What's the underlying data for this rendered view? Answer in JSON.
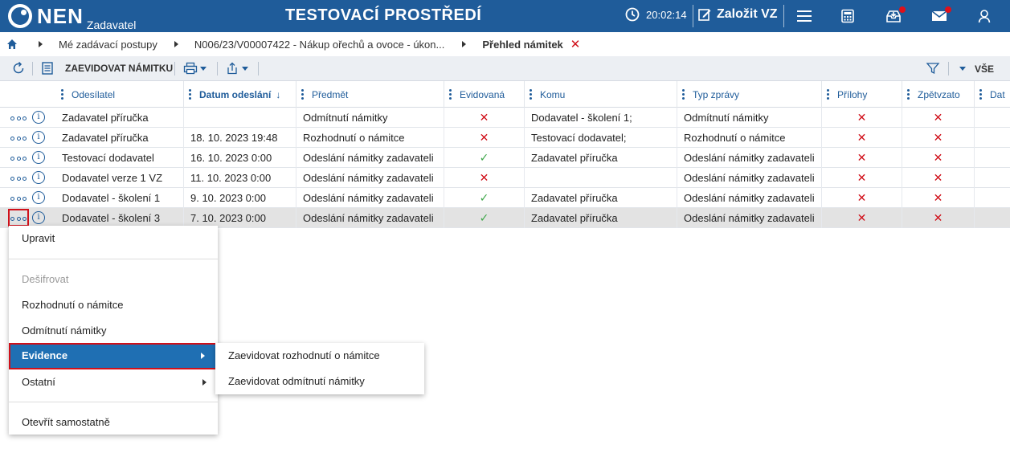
{
  "topbar": {
    "logo_text": "NEN",
    "logo_sub": "Zadavatel",
    "environment_title": "TESTOVACÍ PROSTŘEDÍ",
    "clock": "20:02:14",
    "create_label": "Založit VZ"
  },
  "breadcrumb": {
    "items": [
      "Mé zadávací postupy",
      "N006/23/V00007422 - Nákup ořechů a ovoce - úkon...",
      "Přehled námitek"
    ]
  },
  "toolbar": {
    "register_label": "ZAEVIDOVAT NÁMITKU",
    "filter_value": "VŠE"
  },
  "grid": {
    "columns": [
      "Odesílatel",
      "Datum odeslání",
      "Předmět",
      "Evidovaná",
      "Komu",
      "Typ zprávy",
      "Přílohy",
      "Zpětvzato",
      "Dat"
    ],
    "sort_indicator": "↓",
    "rows": [
      {
        "odesilatel": "Zadavatel příručka",
        "datum": "",
        "predmet": "Odmítnutí námitky",
        "evidovana": "✕",
        "komu": "Dodavatel - školení 1;",
        "typ": "Odmítnutí námitky",
        "prilohy": "✕",
        "zpetvzato": "✕"
      },
      {
        "odesilatel": "Zadavatel příručka",
        "datum": "18. 10. 2023 19:48",
        "predmet": "Rozhodnutí o námitce",
        "evidovana": "✕",
        "komu": "Testovací dodavatel;",
        "typ": "Rozhodnutí o námitce",
        "prilohy": "✕",
        "zpetvzato": "✕"
      },
      {
        "odesilatel": "Testovací dodavatel",
        "datum": "16. 10. 2023 0:00",
        "predmet": "Odeslání námitky zadavateli",
        "evidovana": "✓",
        "komu": "Zadavatel příručka",
        "typ": "Odeslání námitky zadavateli",
        "prilohy": "✕",
        "zpetvzato": "✕"
      },
      {
        "odesilatel": "Dodavatel verze 1 VZ",
        "datum": "11. 10. 2023 0:00",
        "predmet": "Odeslání námitky zadavateli",
        "evidovana": "✕",
        "komu": "",
        "typ": "Odeslání námitky zadavateli",
        "prilohy": "✕",
        "zpetvzato": "✕"
      },
      {
        "odesilatel": "Dodavatel - školení 1",
        "datum": "9. 10. 2023 0:00",
        "predmet": "Odeslání námitky zadavateli",
        "evidovana": "✓",
        "komu": "Zadavatel příručka",
        "typ": "Odeslání námitky zadavateli",
        "prilohy": "✕",
        "zpetvzato": "✕"
      },
      {
        "odesilatel": "Dodavatel - školení 3",
        "datum": "7. 10. 2023 0:00",
        "predmet": "Odeslání námitky zadavateli",
        "evidovana": "✓",
        "komu": "Zadavatel příručka",
        "typ": "Odeslání námitky zadavateli",
        "prilohy": "✕",
        "zpetvzato": "✕"
      }
    ]
  },
  "context_menu": {
    "edit": "Upravit",
    "decrypt": "Dešifrovat",
    "decision": "Rozhodnutí o námitce",
    "rejection": "Odmítnutí námitky",
    "evidence": "Evidence",
    "other": "Ostatní",
    "open_standalone": "Otevřít samostatně"
  },
  "sub_menu": {
    "register_decision": "Zaevidovat rozhodnutí o námitce",
    "register_rejection": "Zaevidovat odmítnutí námitky"
  },
  "colors": {
    "primary": "#1f5c9a",
    "danger": "#d0101a",
    "success": "#3fa74a",
    "menu_active": "#1f6fb3"
  }
}
